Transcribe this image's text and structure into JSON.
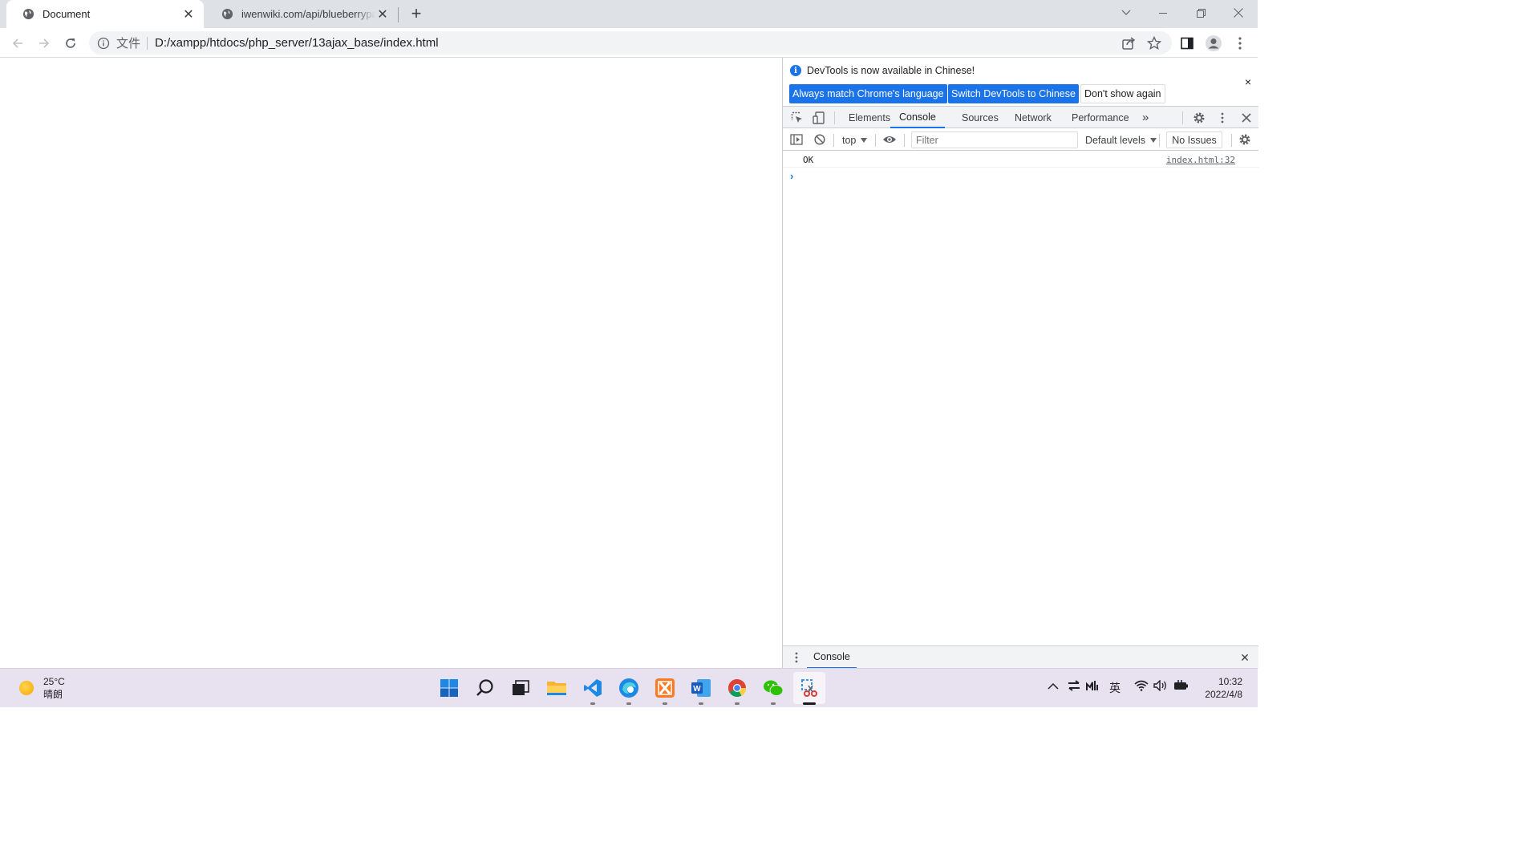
{
  "browser": {
    "tabs": [
      {
        "title": "Document",
        "close": "✕",
        "active": true
      },
      {
        "title": "iwenwiki.com/api/blueberrypai",
        "close": "✕",
        "active": false
      }
    ],
    "new_tab": "+",
    "omnibox": {
      "scheme_label": "文件",
      "url": "D:/xampp/htdocs/php_server/13ajax_base/index.html"
    }
  },
  "devtools": {
    "infobar": {
      "message": "DevTools is now available in Chinese!",
      "buttons": [
        "Always match Chrome's language",
        "Switch DevTools to Chinese",
        "Don't show again"
      ],
      "close": "×"
    },
    "tabs": [
      "Elements",
      "Console",
      "Sources",
      "Network",
      "Performance"
    ],
    "active_tab": "Console",
    "more_tabs": "»",
    "console_toolbar": {
      "context": "top",
      "filter_placeholder": "Filter",
      "levels": "Default levels",
      "issues": "No Issues"
    },
    "messages": [
      {
        "text": "OK",
        "source": "index.html:32"
      }
    ],
    "prompt": "›",
    "drawer_tab": "Console",
    "drawer_close": "✕"
  },
  "taskbar": {
    "weather": {
      "temp": "25°C",
      "condition": "晴朗"
    },
    "apps": [
      "start-icon",
      "search-icon",
      "task-view-icon",
      "file-explorer-icon",
      "vscode-icon",
      "edge-icon",
      "xampp-icon",
      "word-icon",
      "chrome-icon",
      "wechat-icon",
      "snipping-tool-icon"
    ],
    "tray": {
      "ime": "英"
    },
    "clock": {
      "time": "10:32",
      "date": "2022/4/8"
    }
  },
  "colors": {
    "accent": "#1a73e8",
    "tabstrip": "#dee1e6",
    "taskbar": "#e8e2f0"
  }
}
